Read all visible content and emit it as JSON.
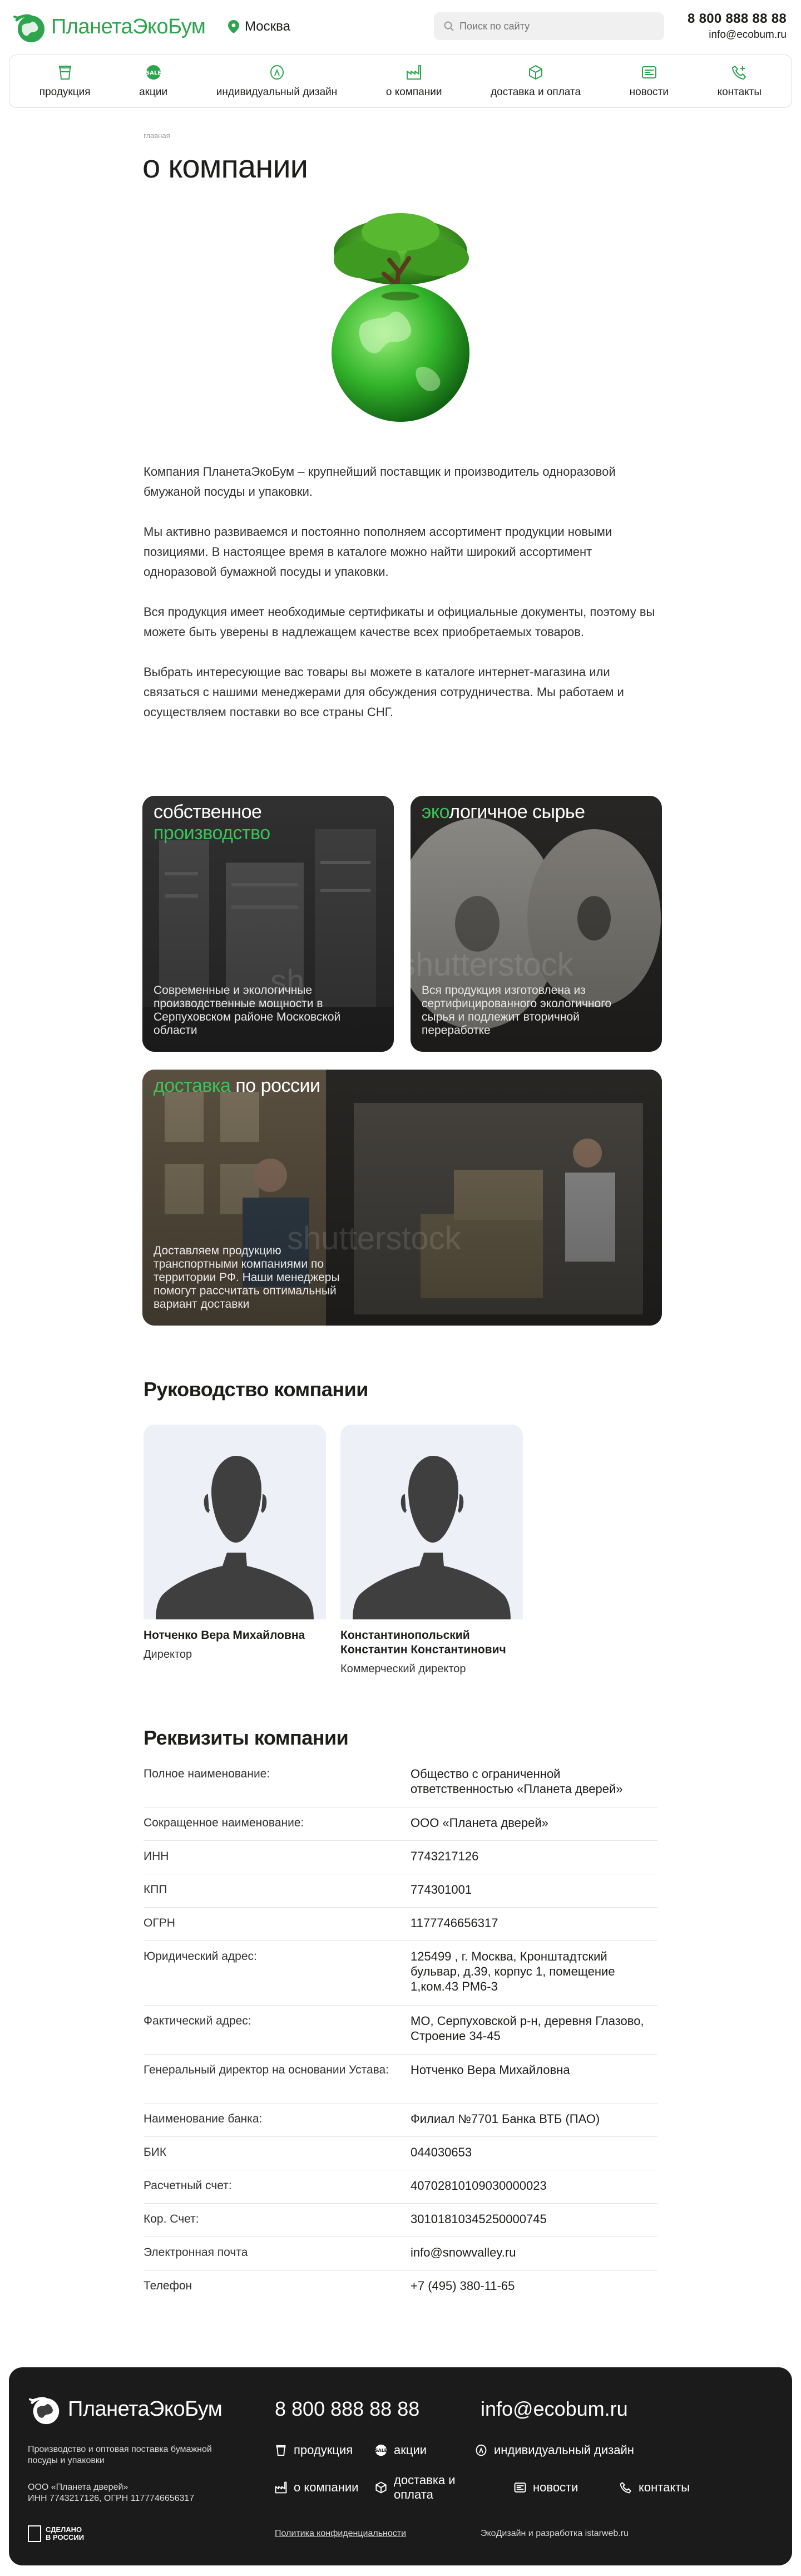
{
  "header": {
    "brand": "ПланетаЭкоБум",
    "city": "Москва",
    "search_placeholder": "Поиск по сайту",
    "phone": "8 800 888 88 88",
    "email": "info@ecobum.ru"
  },
  "nav": [
    {
      "label": "продукция",
      "icon": "cup-icon"
    },
    {
      "label": "акции",
      "icon": "sale-badge-icon"
    },
    {
      "label": "индивидуальный дизайн",
      "icon": "design-icon"
    },
    {
      "label": "о компании",
      "icon": "factory-icon"
    },
    {
      "label": "доставка и оплата",
      "icon": "box-icon"
    },
    {
      "label": "новости",
      "icon": "news-icon"
    },
    {
      "label": "контакты",
      "icon": "phone-icon"
    }
  ],
  "page": {
    "breadcrumb": "главная",
    "title": "о компании",
    "paragraphs": [
      "Компания ПланетаЭкоБум – крупнейший поставщик и производитель одноразовой бмужаной посуды и упаковки.",
      "Мы активно развиваемся и постоянно пополняем ассортимент продукции новыми позициями. В настоящее время в каталоге можно найти широкий ассортимент одноразовой бумажной посуды и упаковки.",
      "Вся продукция имеет необходимые сертификаты и официальные документы, поэтому вы можете быть уверены в надлежащем качестве всех приобретаемых товаров.",
      "Выбрать интересующие вас товары вы можете в каталоге интернет-магазина или связаться с нашими менеджерами для обсуждения сотрудничества. Мы работаем и осуществляем поставки во все страны СНГ."
    ]
  },
  "features": {
    "production": {
      "title_white": "собственное",
      "title_green": "производство",
      "text": "Современные и экологичные производственные мощности в Серпуховском районе Московской области"
    },
    "eco": {
      "title_green": "эко",
      "title_white": "логичное сырье",
      "text": "Вся продукция изготовлена из сертифицированного экологичного сырья и подлежит вторичной переработке"
    },
    "delivery": {
      "title_green": "доставка",
      "title_white": " по россии",
      "text": "Доставляем продукцию транспортными компаниями по территории РФ. Наши менеджеры помогут рассчитать оптимальный вариант доставки"
    }
  },
  "management": {
    "heading": "Руководство компании",
    "people": [
      {
        "name": "Нотченко Вера Михайловна",
        "role": "Директор"
      },
      {
        "name": "Константинопольский Константин Константинович",
        "role": "Коммерческий директор"
      }
    ]
  },
  "requisites": {
    "heading": "Реквизиты компании",
    "rows": [
      {
        "k": "Полное наименование:",
        "v": "Общество с ограниченной ответственностью «Планета дверей»"
      },
      {
        "k": "Сокращенное наименование:",
        "v": "ООО «Планета дверей»"
      },
      {
        "k": "ИНН",
        "v": "7743217126"
      },
      {
        "k": "КПП",
        "v": "774301001"
      },
      {
        "k": "ОГРН",
        "v": "1177746656317"
      },
      {
        "k": "Юридический адрес:",
        "v": "125499 , г. Москва, Кронштадтский бульвар, д.39, корпус 1, помещение 1,ком.43 РМ6-3"
      },
      {
        "k": "Фактический адрес:",
        "v": "МО, Серпуховской р-н, деревня Глазово, Строение 34-45"
      },
      {
        "k": "Генеральный директор на основании Устава:",
        "v": "Нотченко Вера Михайловна"
      },
      {
        "k": "Наименование банка:",
        "v": "Филиал №7701 Банка ВТБ (ПАО)"
      },
      {
        "k": "БИК",
        "v": "044030653"
      },
      {
        "k": "Расчетный счет:",
        "v": "40702810109030000023"
      },
      {
        "k": "Кор. Счет:",
        "v": "30101810345250000745"
      },
      {
        "k": "Электронная почта",
        "v": "info@snowvalley.ru"
      },
      {
        "k": "Телефон",
        "v": "+7 (495) 380-11-65"
      }
    ]
  },
  "footer": {
    "brand": "ПланетаЭкоБум",
    "phone": "8 800 888 88 88",
    "email": "info@ecobum.ru",
    "desc": "Производство и оптовая поставка бумажной посуды и упаковки",
    "org_line1": "ООО «Планета дверей»",
    "org_line2": "ИНН 7743217126, ОГРН 1177746656317",
    "made_line1": "СДЕЛАНО",
    "made_line2": "В РОССИИ",
    "nav": [
      {
        "label": "продукция",
        "icon": "cup-icon"
      },
      {
        "label": "акции",
        "icon": "sale-badge-icon"
      },
      {
        "label": "индивидуальный дизайн",
        "icon": "design-icon"
      },
      {
        "label": "о компании",
        "icon": "factory-icon"
      },
      {
        "label": "доставка и оплата",
        "icon": "box-icon"
      },
      {
        "label": "новости",
        "icon": "news-icon"
      },
      {
        "label": "контакты",
        "icon": "phone-icon"
      }
    ],
    "policy": "Политика конфиденциальности",
    "developer": "ЭкоДизайн и разработка istarweb.ru"
  },
  "colors": {
    "accent": "#2ea44f",
    "footer_bg": "#1b1b1b",
    "placeholder_bg": "#eef0f7"
  }
}
